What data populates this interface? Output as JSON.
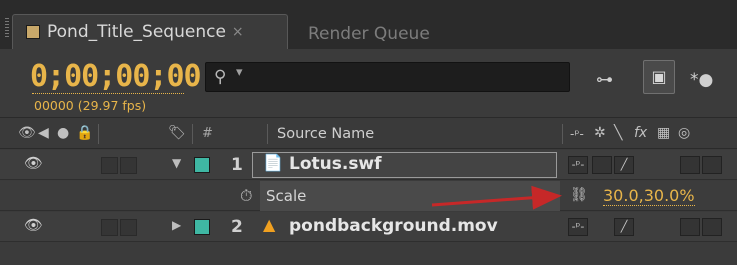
{
  "tabs": {
    "active_label": "Pond_Title_Sequence",
    "active_close": "×",
    "inactive_label": "Render Queue"
  },
  "time": {
    "timecode": "0;00;00;00",
    "frames_fps": "00000 (29.97 fps)"
  },
  "search": {
    "icon": "magnifier-icon",
    "caret": "▾",
    "value": ""
  },
  "toolbar": {
    "graph_icon_glyph": "⊶",
    "box_icon_glyph": "▣",
    "draft3d_icon_glyph": "*●"
  },
  "columns": {
    "hash": "#",
    "source_name": "Source Name"
  },
  "layers": [
    {
      "index": "1",
      "name": "Lotus.swf",
      "file_icon": "swf-file-icon",
      "expanded": true,
      "label_color": "#3fb7a3"
    },
    {
      "index": "2",
      "name": "pondbackground.mov",
      "file_icon": "vlc-cone-icon",
      "expanded": false,
      "label_color": "#3fb7a3"
    }
  ],
  "property": {
    "name": "Scale",
    "value": "30.0,30.0%",
    "link_icon": "chain-link-icon"
  },
  "annotation": {
    "arrow_color": "#c62828"
  },
  "colors": {
    "timecode": "#e8b54a",
    "background": "#3b3b3b",
    "tab_bar": "#2b2b2b"
  }
}
